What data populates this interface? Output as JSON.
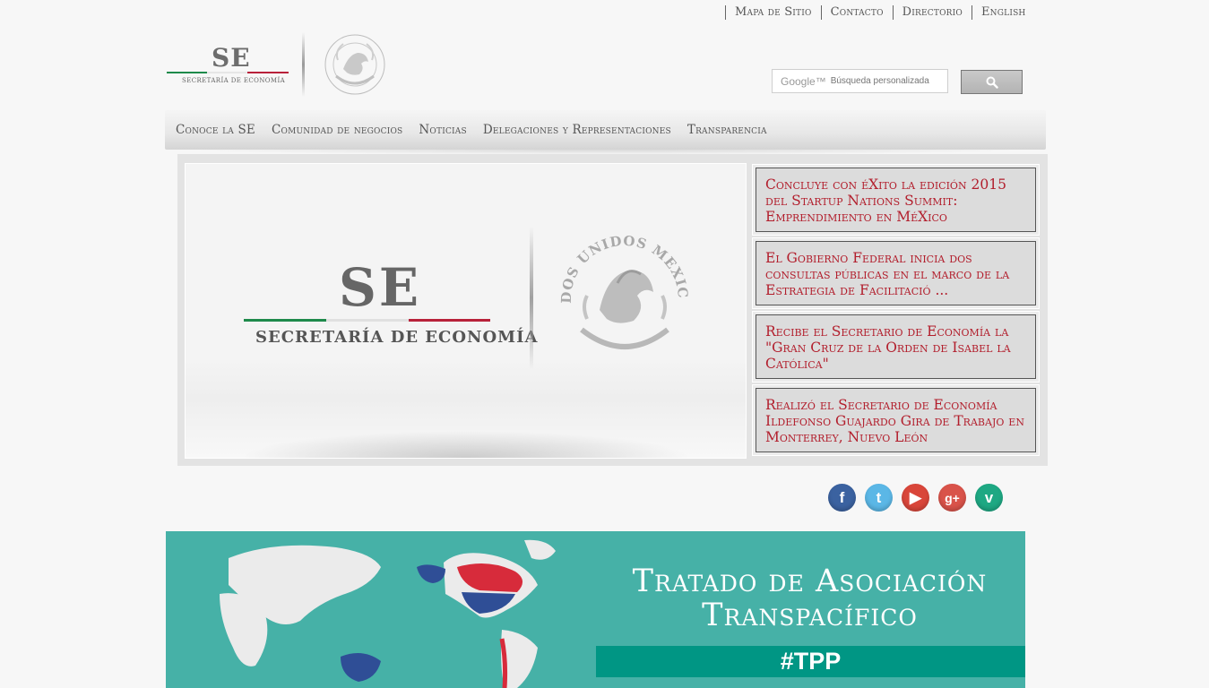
{
  "top_links": [
    "Mapa de Sitio",
    "Contacto",
    "Directorio",
    "English"
  ],
  "logo": {
    "initials": "SE",
    "subtitle": "SECRETARÍA DE ECONOMÍA"
  },
  "search": {
    "brand": "Google™",
    "placeholder": "Búsqueda personalizada"
  },
  "main_nav": [
    "Conoce la SE",
    "Comunidad de negocios",
    "Noticias",
    "Delegaciones y Representaciones",
    "Transparencia"
  ],
  "slider": {
    "initials": "SE",
    "subtitle": "SECRETARÍA DE ECONOMÍA",
    "news": [
      "Concluye con éXito la edición 2015 del Startup Nations Summit: Emprendimiento en MéXico",
      "El Gobierno Federal inicia dos consultas públicas en el marco de la Estrategia de Facilitació ...",
      "Recibe el Secretario de Economía la \"Gran Cruz de la Orden de Isabel la Católica\"",
      "Realizó el Secretario de Economía Ildefonso Guajardo Gira de Trabajo en Monterrey, Nuevo León"
    ]
  },
  "social": [
    {
      "name": "facebook-icon",
      "glyph": "f",
      "color": "#3b62a0"
    },
    {
      "name": "twitter-icon",
      "glyph": "t",
      "color": "#5bb7e6"
    },
    {
      "name": "youtube-icon",
      "glyph": "▶",
      "color": "#d9463a"
    },
    {
      "name": "google-plus-icon",
      "glyph": "g+",
      "color": "#d9534a"
    },
    {
      "name": "vine-icon",
      "glyph": "v",
      "color": "#1ea883"
    }
  ],
  "banner": {
    "title_line1": "Tratado de Asociación",
    "title_line2": "Transpacífico",
    "tag": "#TPP"
  },
  "colors": {
    "accent_red": "#b21e2c",
    "banner_teal": "#46b1a7",
    "banner_dark_teal": "#009684"
  }
}
